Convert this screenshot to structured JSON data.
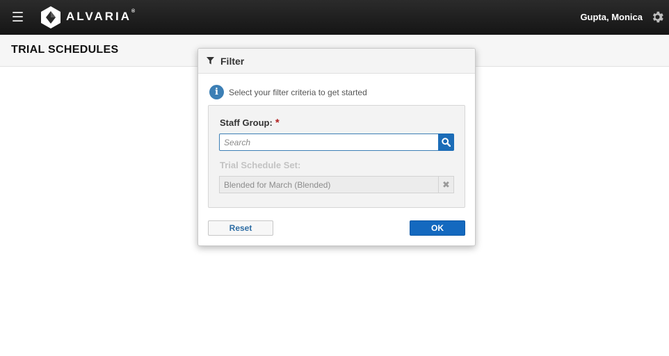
{
  "app": {
    "brand": "ALVARIA",
    "brand_mark": "®",
    "user_name": "Gupta, Monica"
  },
  "page": {
    "title": "TRIAL SCHEDULES"
  },
  "filter_dialog": {
    "title": "Filter",
    "info_text": "Select your filter criteria to get started",
    "staff_group_label": "Staff Group:",
    "required_marker": "*",
    "search_placeholder": "Search",
    "search_value": "",
    "trial_schedule_set_label": "Trial Schedule Set:",
    "trial_schedule_set_value": "Blended for March (Blended)",
    "reset_label": "Reset",
    "ok_label": "OK"
  },
  "icons": {
    "menu": "hamburger-menu-icon",
    "logo": "alvaria-logo-icon",
    "settings": "gear-icon",
    "filter": "filter-funnel-icon",
    "info": "info-icon",
    "search": "search-icon",
    "clear": "close-x-icon"
  },
  "colors": {
    "topbar": "#1f1f1f",
    "primary_blue": "#1469bf",
    "info_blue": "#3c7fb5",
    "required_red": "#b22222"
  }
}
